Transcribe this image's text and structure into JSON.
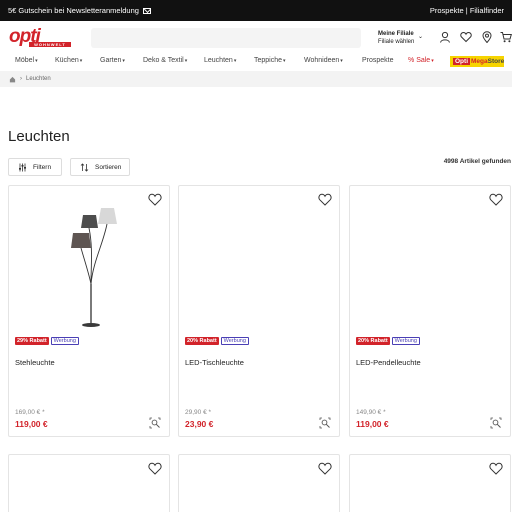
{
  "topbar": {
    "promo": "5€ Gutschein bei Newsletteranmeldung",
    "link_prospekte": "Prospekte",
    "separator": "|",
    "link_filialfinder": "Filialfinder"
  },
  "header": {
    "logo_text": "opti",
    "logo_sub": "WOHNWELT",
    "store_title": "Meine Filiale",
    "store_sub": "Filiale wählen"
  },
  "nav": {
    "items": [
      "Möbel",
      "Küchen",
      "Garten",
      "Deko & Textil",
      "Leuchten",
      "Teppiche",
      "Wohnideen",
      "Prospekte",
      "Sale"
    ],
    "sale_prefix": "%",
    "megastore_opti": "Opti",
    "megastore_mega": "Mega",
    "megastore_store": "Store"
  },
  "breadcrumb": {
    "current": "Leuchten"
  },
  "page": {
    "title": "Leuchten",
    "filter_label": "Filtern",
    "sort_label": "Sortieren",
    "count": "4998 Artikel gefunden"
  },
  "products": [
    {
      "discount": "29% Rabatt",
      "ad": "Werbung",
      "name": "Stehleuchte",
      "old_price": "169,00 € *",
      "price": "119,00 €"
    },
    {
      "discount": "20% Rabatt",
      "ad": "Werbung",
      "name": "LED-Tischleuchte",
      "old_price": "29,90 € *",
      "price": "23,90 €"
    },
    {
      "discount": "20% Rabatt",
      "ad": "Werbung",
      "name": "LED-Pendelleuchte",
      "old_price": "149,90 € *",
      "price": "119,00 €"
    }
  ],
  "colors": {
    "brand_red": "#d2232a",
    "megastore_yellow": "#f6d400",
    "ad_purple": "#4a3fb5"
  }
}
